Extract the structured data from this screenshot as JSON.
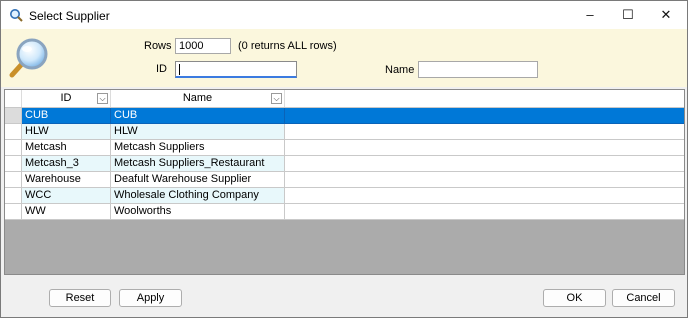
{
  "window": {
    "title": "Select Supplier"
  },
  "window_controls": {
    "minimize": "–",
    "maximize": "☐",
    "close": "✕"
  },
  "filter": {
    "rows_label": "Rows",
    "rows_value": "1000",
    "rows_hint": "(0 returns ALL rows)",
    "id_label": "ID",
    "id_value": "",
    "name_label": "Name",
    "name_value": ""
  },
  "grid": {
    "columns": [
      "ID",
      "Name"
    ],
    "rows": [
      {
        "id": "CUB",
        "name": "CUB",
        "selected": true
      },
      {
        "id": "HLW",
        "name": "HLW"
      },
      {
        "id": "Metcash",
        "name": "Metcash Suppliers"
      },
      {
        "id": "Metcash_3",
        "name": "Metcash Suppliers_Restaurant"
      },
      {
        "id": "Warehouse",
        "name": "Deafult Warehouse Supplier"
      },
      {
        "id": "WCC",
        "name": "Wholesale Clothing Company"
      },
      {
        "id": "WW",
        "name": "Woolworths"
      }
    ],
    "row_colors": {
      "selected": "#0078d7",
      "alt": "#e8f8fb",
      "normal": "#ffffff"
    }
  },
  "buttons": {
    "reset": "Reset",
    "apply": "Apply",
    "ok": "OK",
    "cancel": "Cancel"
  }
}
